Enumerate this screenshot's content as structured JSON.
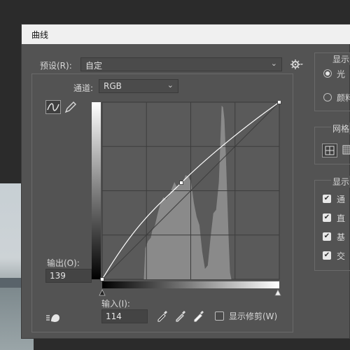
{
  "dialog": {
    "title": "曲线"
  },
  "preset": {
    "label": "预设(R):",
    "value": "自定"
  },
  "channel": {
    "label": "通道:",
    "value": "RGB"
  },
  "output": {
    "label": "输出(O):",
    "value": "139"
  },
  "input": {
    "label": "输入(I):",
    "value": "114"
  },
  "show_clipping": {
    "label": "显示修剪(W)",
    "checked": false
  },
  "display_group": {
    "title": "显示",
    "options": [
      "光",
      "颜料"
    ],
    "selected": "光"
  },
  "grid_group": {
    "title": "网格"
  },
  "show_group": {
    "title": "显示",
    "items": [
      "通",
      "直",
      "基",
      "交"
    ]
  },
  "icons": [
    "curve-icon",
    "pencil-icon",
    "gear-icon",
    "black-eyedropper-icon",
    "gray-eyedropper-icon",
    "white-eyedropper-icon",
    "hand-adjust-icon",
    "grid-small-icon",
    "grid-large-icon"
  ],
  "curve_points": [
    [
      0,
      0
    ],
    [
      114,
      139
    ],
    [
      255,
      255
    ]
  ],
  "colors": {
    "dialog": "#535353",
    "plot": "#5a5a5a",
    "histogram": "#8a8a8a",
    "curve": "#ffffff"
  }
}
